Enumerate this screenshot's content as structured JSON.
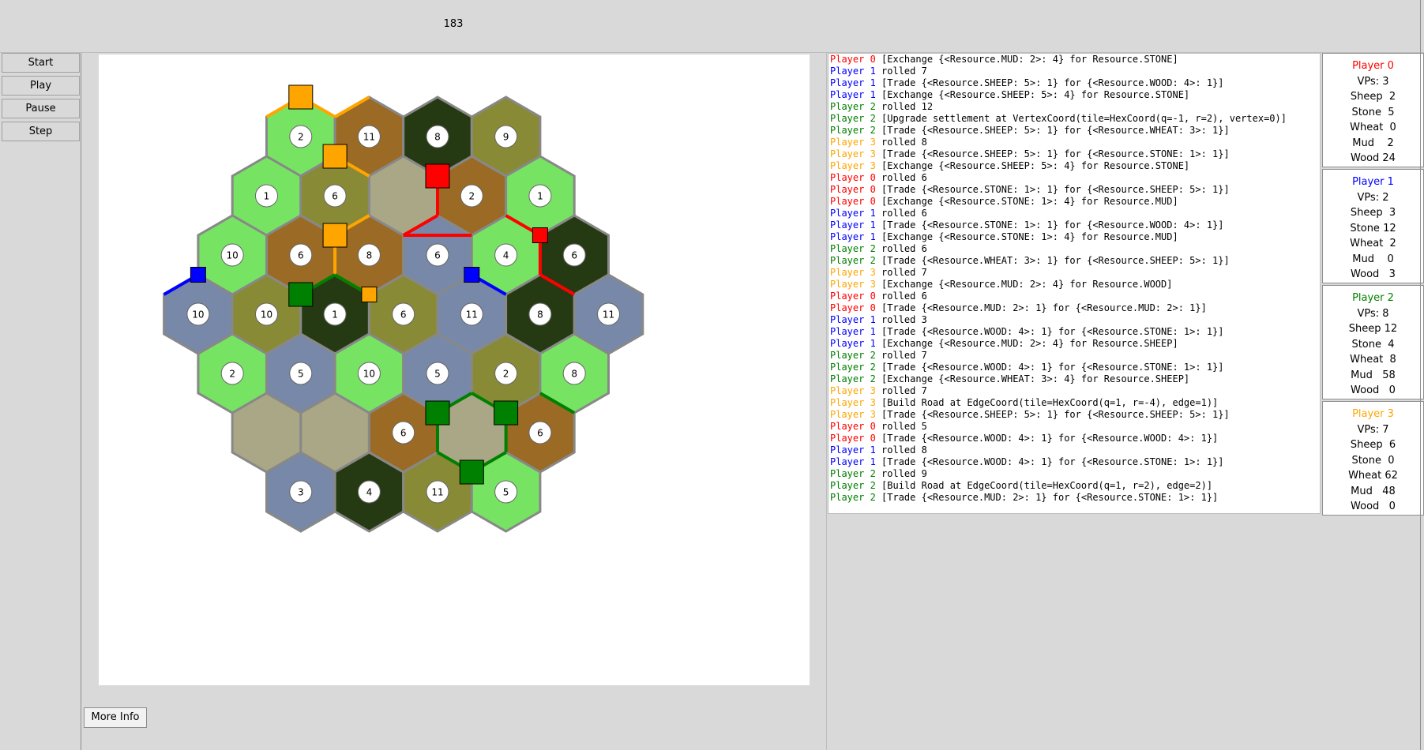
{
  "counter": "183",
  "controls": {
    "start": "Start",
    "play": "Play",
    "pause": "Pause",
    "step": "Step",
    "more_info": "More Info"
  },
  "colors": {
    "p0": "#ff0000",
    "p1": "#0000ff",
    "p2": "#008000",
    "p3": "#ffa500",
    "grass": "#77e363",
    "olive": "#898a35",
    "brown": "#9b6a25",
    "dark": "#253a12",
    "sand": "#a9a786",
    "slate": "#7788a8"
  },
  "hexes": [
    {
      "q": 0,
      "r": -4,
      "color": "grass",
      "number": "2"
    },
    {
      "q": 1,
      "r": -4,
      "color": "brown",
      "number": "11"
    },
    {
      "q": 2,
      "r": -4,
      "color": "dark",
      "number": "8"
    },
    {
      "q": 3,
      "r": -4,
      "color": "olive",
      "number": "9"
    },
    {
      "q": -1,
      "r": -3,
      "color": "grass",
      "number": "1"
    },
    {
      "q": 0,
      "r": -3,
      "color": "olive",
      "number": "6"
    },
    {
      "q": 1,
      "r": -3,
      "color": "sand",
      "number": ""
    },
    {
      "q": 2,
      "r": -3,
      "color": "brown",
      "number": "2"
    },
    {
      "q": 3,
      "r": -3,
      "color": "grass",
      "number": "1"
    },
    {
      "q": -2,
      "r": -2,
      "color": "grass",
      "number": "10"
    },
    {
      "q": -1,
      "r": -2,
      "color": "brown",
      "number": "6"
    },
    {
      "q": 0,
      "r": -2,
      "color": "brown",
      "number": "8"
    },
    {
      "q": 1,
      "r": -2,
      "color": "slate",
      "number": "6"
    },
    {
      "q": 2,
      "r": -2,
      "color": "grass",
      "number": "4"
    },
    {
      "q": 3,
      "r": -2,
      "color": "dark",
      "number": "6"
    },
    {
      "q": -3,
      "r": -1,
      "color": "slate",
      "number": "10"
    },
    {
      "q": -2,
      "r": -1,
      "color": "olive",
      "number": "10"
    },
    {
      "q": -1,
      "r": -1,
      "color": "dark",
      "number": "1"
    },
    {
      "q": 0,
      "r": -1,
      "color": "olive",
      "number": "6"
    },
    {
      "q": 1,
      "r": -1,
      "color": "slate",
      "number": "11"
    },
    {
      "q": 2,
      "r": -1,
      "color": "dark",
      "number": "8"
    },
    {
      "q": 3,
      "r": -1,
      "color": "slate",
      "number": "11"
    },
    {
      "q": -3,
      "r": 0,
      "color": "grass",
      "number": "2"
    },
    {
      "q": -2,
      "r": 0,
      "color": "slate",
      "number": "5"
    },
    {
      "q": -1,
      "r": 0,
      "color": "grass",
      "number": "10"
    },
    {
      "q": 0,
      "r": 0,
      "color": "slate",
      "number": "5"
    },
    {
      "q": 1,
      "r": 0,
      "color": "olive",
      "number": "2"
    },
    {
      "q": 2,
      "r": 0,
      "color": "grass",
      "number": "8"
    },
    {
      "q": -3,
      "r": 1,
      "color": "sand",
      "number": ""
    },
    {
      "q": -2,
      "r": 1,
      "color": "sand",
      "number": ""
    },
    {
      "q": -1,
      "r": 1,
      "color": "brown",
      "number": "6"
    },
    {
      "q": 0,
      "r": 1,
      "color": "sand",
      "number": ""
    },
    {
      "q": 1,
      "r": 1,
      "color": "brown",
      "number": "6"
    },
    {
      "q": -3,
      "r": 2,
      "color": "slate",
      "number": "3"
    },
    {
      "q": -2,
      "r": 2,
      "color": "dark",
      "number": "4"
    },
    {
      "q": -1,
      "r": 2,
      "color": "olive",
      "number": "11"
    },
    {
      "q": 0,
      "r": 2,
      "color": "grass",
      "number": "5"
    }
  ],
  "log": [
    {
      "player": "Player 0",
      "cls": "p0",
      "text": "[Exchange {<Resource.MUD: 2>: 4} for Resource.STONE]"
    },
    {
      "player": "Player 1",
      "cls": "p1",
      "text": "rolled 7"
    },
    {
      "player": "Player 1",
      "cls": "p1",
      "text": "[Trade {<Resource.SHEEP: 5>: 1} for {<Resource.WOOD: 4>: 1}]"
    },
    {
      "player": "Player 1",
      "cls": "p1",
      "text": "[Exchange {<Resource.SHEEP: 5>: 4} for Resource.STONE]"
    },
    {
      "player": "Player 2",
      "cls": "p2",
      "text": "rolled 12"
    },
    {
      "player": "Player 2",
      "cls": "p2",
      "text": "[Upgrade settlement at VertexCoord(tile=HexCoord(q=-1, r=2), vertex=0)]"
    },
    {
      "player": "Player 2",
      "cls": "p2",
      "text": "[Trade {<Resource.SHEEP: 5>: 1} for {<Resource.WHEAT: 3>: 1}]"
    },
    {
      "player": "Player 3",
      "cls": "p3",
      "text": "rolled 8"
    },
    {
      "player": "Player 3",
      "cls": "p3",
      "text": "[Trade {<Resource.SHEEP: 5>: 1} for {<Resource.STONE: 1>: 1}]"
    },
    {
      "player": "Player 3",
      "cls": "p3",
      "text": "[Exchange {<Resource.SHEEP: 5>: 4} for Resource.STONE]"
    },
    {
      "player": "Player 0",
      "cls": "p0",
      "text": "rolled 6"
    },
    {
      "player": "Player 0",
      "cls": "p0",
      "text": "[Trade {<Resource.STONE: 1>: 1} for {<Resource.SHEEP: 5>: 1}]"
    },
    {
      "player": "Player 0",
      "cls": "p0",
      "text": "[Exchange {<Resource.STONE: 1>: 4} for Resource.MUD]"
    },
    {
      "player": "Player 1",
      "cls": "p1",
      "text": "rolled 6"
    },
    {
      "player": "Player 1",
      "cls": "p1",
      "text": "[Trade {<Resource.STONE: 1>: 1} for {<Resource.WOOD: 4>: 1}]"
    },
    {
      "player": "Player 1",
      "cls": "p1",
      "text": "[Exchange {<Resource.STONE: 1>: 4} for Resource.MUD]"
    },
    {
      "player": "Player 2",
      "cls": "p2",
      "text": "rolled 6"
    },
    {
      "player": "Player 2",
      "cls": "p2",
      "text": "[Trade {<Resource.WHEAT: 3>: 1} for {<Resource.SHEEP: 5>: 1}]"
    },
    {
      "player": "Player 3",
      "cls": "p3",
      "text": "rolled 7"
    },
    {
      "player": "Player 3",
      "cls": "p3",
      "text": "[Exchange {<Resource.MUD: 2>: 4} for Resource.WOOD]"
    },
    {
      "player": "Player 0",
      "cls": "p0",
      "text": "rolled 6"
    },
    {
      "player": "Player 0",
      "cls": "p0",
      "text": "[Trade {<Resource.MUD: 2>: 1} for {<Resource.MUD: 2>: 1}]"
    },
    {
      "player": "Player 1",
      "cls": "p1",
      "text": "rolled 3"
    },
    {
      "player": "Player 1",
      "cls": "p1",
      "text": "[Trade {<Resource.WOOD: 4>: 1} for {<Resource.STONE: 1>: 1}]"
    },
    {
      "player": "Player 1",
      "cls": "p1",
      "text": "[Exchange {<Resource.MUD: 2>: 4} for Resource.SHEEP]"
    },
    {
      "player": "Player 2",
      "cls": "p2",
      "text": "rolled 7"
    },
    {
      "player": "Player 2",
      "cls": "p2",
      "text": "[Trade {<Resource.WOOD: 4>: 1} for {<Resource.STONE: 1>: 1}]"
    },
    {
      "player": "Player 2",
      "cls": "p2",
      "text": "[Exchange {<Resource.WHEAT: 3>: 4} for Resource.SHEEP]"
    },
    {
      "player": "Player 3",
      "cls": "p3",
      "text": "rolled 7"
    },
    {
      "player": "Player 3",
      "cls": "p3",
      "text": "[Build Road at EdgeCoord(tile=HexCoord(q=1, r=-4), edge=1)]"
    },
    {
      "player": "Player 3",
      "cls": "p3",
      "text": "[Trade {<Resource.SHEEP: 5>: 1} for {<Resource.SHEEP: 5>: 1}]"
    },
    {
      "player": "Player 0",
      "cls": "p0",
      "text": "rolled 5"
    },
    {
      "player": "Player 0",
      "cls": "p0",
      "text": "[Trade {<Resource.WOOD: 4>: 1} for {<Resource.WOOD: 4>: 1}]"
    },
    {
      "player": "Player 1",
      "cls": "p1",
      "text": "rolled 8"
    },
    {
      "player": "Player 1",
      "cls": "p1",
      "text": "[Trade {<Resource.WOOD: 4>: 1} for {<Resource.STONE: 1>: 1}]"
    },
    {
      "player": "Player 2",
      "cls": "p2",
      "text": "rolled 9"
    },
    {
      "player": "Player 2",
      "cls": "p2",
      "text": "[Build Road at EdgeCoord(tile=HexCoord(q=1, r=2), edge=2)]"
    },
    {
      "player": "Player 2",
      "cls": "p2",
      "text": "[Trade {<Resource.MUD: 2>: 1} for {<Resource.STONE: 1>: 1}]"
    }
  ],
  "players": [
    {
      "name": "Player 0",
      "cls": "p0",
      "stats": [
        "VPs: 3",
        "Sheep  2",
        "Stone  5",
        "Wheat  0",
        "Mud    2",
        "Wood 24"
      ]
    },
    {
      "name": "Player 1",
      "cls": "p1",
      "stats": [
        "VPs: 2",
        "Sheep  3",
        "Stone 12",
        "Wheat  2",
        "Mud    0",
        "Wood   3"
      ]
    },
    {
      "name": "Player 2",
      "cls": "p2",
      "stats": [
        "VPs: 8",
        "Sheep 12",
        "Stone  4",
        "Wheat  8",
        "Mud   58",
        "Wood   0"
      ]
    },
    {
      "name": "Player 3",
      "cls": "p3",
      "stats": [
        "VPs: 7",
        "Sheep  6",
        "Stone  0",
        "Wheat 62",
        "Mud   48",
        "Wood   0"
      ]
    }
  ]
}
